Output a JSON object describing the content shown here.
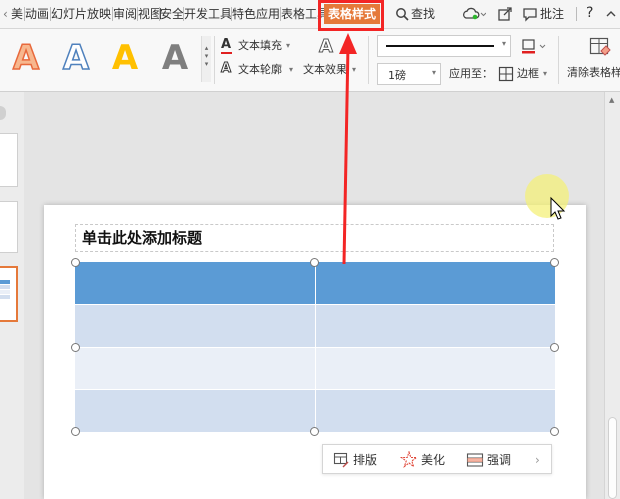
{
  "tabbar": {
    "tabs": [
      "美",
      "动画",
      "幻灯片放映",
      "审阅",
      "视图",
      "安全",
      "开发工具",
      "特色应用",
      "表格工具"
    ],
    "active_tab": "表格样式",
    "search_label": "查找",
    "annotate_label": "批注",
    "help_label": "?"
  },
  "ribbon": {
    "text_fill_label": "文本填充",
    "text_outline_label": "文本轮廓",
    "text_effect_label": "文本效果",
    "line_weight_value": "1磅",
    "apply_to_label": "应用至：",
    "border_label": "边框",
    "clear_style_label": "清除表格样"
  },
  "slide": {
    "title_placeholder": "单击此处添加标题",
    "table_colors": {
      "header": "#5b9bd5",
      "band1": "#d2deef",
      "band2": "#eaeff7"
    }
  },
  "float_toolbar": {
    "layout_label": "排版",
    "beautify_label": "美化",
    "emphasis_label": "强调"
  },
  "colors": {
    "accent": "#e5793a",
    "annotation": "#f32525"
  }
}
